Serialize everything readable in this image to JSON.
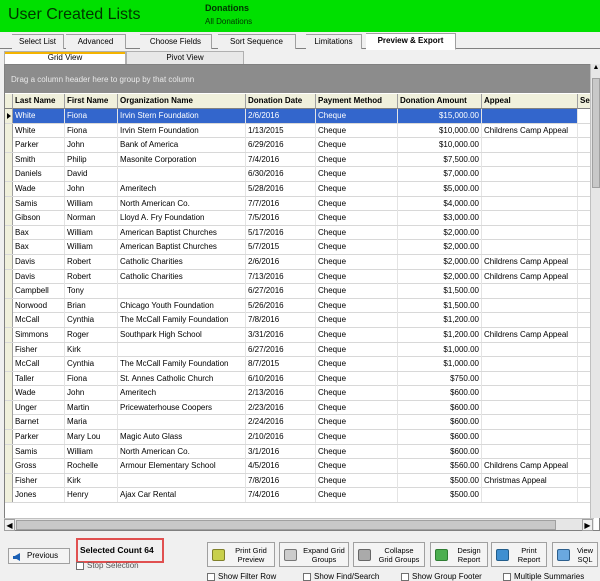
{
  "header": {
    "title": "User Created Lists",
    "subtitle": "Donations",
    "subtitle2": "All Donations",
    "bg_color": "#00e000"
  },
  "tabs": [
    {
      "label": "Select List"
    },
    {
      "label": "Advanced"
    },
    {
      "label": "Choose Fields"
    },
    {
      "label": "Sort Sequence"
    },
    {
      "label": "Limitations"
    },
    {
      "label": "Preview & Export",
      "active": true
    }
  ],
  "subtabs": [
    {
      "label": "Grid View",
      "active": true
    },
    {
      "label": "Pivot View"
    }
  ],
  "grid": {
    "group_hint": "Drag a column header here to group by that column",
    "columns": [
      "Last Name",
      "First Name",
      "Organization Name",
      "Donation Date",
      "Payment Method",
      "Donation Amount",
      "Appeal",
      "Ser"
    ],
    "rows": [
      [
        "White",
        "Fiona",
        "Irvin Stern Foundation",
        "2/6/2016",
        "Cheque",
        "$15,000.00",
        ""
      ],
      [
        "White",
        "Fiona",
        "Irvin Stern Foundation",
        "1/13/2015",
        "Cheque",
        "$10,000.00",
        "Childrens Camp  Appeal"
      ],
      [
        "Parker",
        "John",
        "Bank of America",
        "6/29/2016",
        "Cheque",
        "$10,000.00",
        ""
      ],
      [
        "Smith",
        "Philip",
        "Masonite Corporation",
        "7/4/2016",
        "Cheque",
        "$7,500.00",
        ""
      ],
      [
        "Daniels",
        "David",
        "",
        "6/30/2016",
        "Cheque",
        "$7,000.00",
        ""
      ],
      [
        "Wade",
        "John",
        "Ameritech",
        "5/28/2016",
        "Cheque",
        "$5,000.00",
        ""
      ],
      [
        "Samis",
        "William",
        "North American Co.",
        "7/7/2016",
        "Cheque",
        "$4,000.00",
        ""
      ],
      [
        "Gibson",
        "Norman",
        "Lloyd A. Fry Foundation",
        "7/5/2016",
        "Cheque",
        "$3,000.00",
        ""
      ],
      [
        "Bax",
        "William",
        "American Baptist Churches",
        "5/17/2016",
        "Cheque",
        "$2,000.00",
        ""
      ],
      [
        "Bax",
        "William",
        "American Baptist Churches",
        "5/7/2015",
        "Cheque",
        "$2,000.00",
        ""
      ],
      [
        "Davis",
        "Robert",
        "Catholic Charities",
        "2/6/2016",
        "Cheque",
        "$2,000.00",
        "Childrens Camp  Appeal"
      ],
      [
        "Davis",
        "Robert",
        "Catholic Charities",
        "7/13/2016",
        "Cheque",
        "$2,000.00",
        "Childrens Camp  Appeal"
      ],
      [
        "Campbell",
        "Tony",
        "",
        "6/27/2016",
        "Cheque",
        "$1,500.00",
        ""
      ],
      [
        "Norwood",
        "Brian",
        "Chicago Youth Foundation",
        "5/26/2016",
        "Cheque",
        "$1,500.00",
        ""
      ],
      [
        "McCall",
        "Cynthia",
        "The McCall Family Foundation",
        "7/8/2016",
        "Cheque",
        "$1,200.00",
        ""
      ],
      [
        "Simmons",
        "Roger",
        "Southpark High School",
        "3/31/2016",
        "Cheque",
        "$1,200.00",
        "Childrens Camp  Appeal"
      ],
      [
        "Fisher",
        "Kirk",
        "",
        "6/27/2016",
        "Cheque",
        "$1,000.00",
        ""
      ],
      [
        "McCall",
        "Cynthia",
        "The McCall Family Foundation",
        "8/7/2015",
        "Cheque",
        "$1,000.00",
        ""
      ],
      [
        "Taller",
        "Fiona",
        "St. Annes Catholic Church",
        "6/10/2016",
        "Cheque",
        "$750.00",
        ""
      ],
      [
        "Wade",
        "John",
        "Ameritech",
        "2/13/2016",
        "Cheque",
        "$600.00",
        ""
      ],
      [
        "Unger",
        "Martin",
        "Pricewaterhouse Coopers",
        "2/23/2016",
        "Cheque",
        "$600.00",
        ""
      ],
      [
        "Barnet",
        "Maria",
        "",
        "2/24/2016",
        "Cheque",
        "$600.00",
        ""
      ],
      [
        "Parker",
        "Mary Lou",
        "Magic Auto Glass",
        "2/10/2016",
        "Cheque",
        "$600.00",
        ""
      ],
      [
        "Samis",
        "William",
        "North American Co.",
        "3/1/2016",
        "Cheque",
        "$600.00",
        ""
      ],
      [
        "Gross",
        "Rochelle",
        "Armour Elementary School",
        "4/5/2016",
        "Cheque",
        "$560.00",
        "Childrens Camp  Appeal"
      ],
      [
        "Fisher",
        "Kirk",
        "",
        "7/8/2016",
        "Cheque",
        "$500.00",
        "Christmas Appeal"
      ],
      [
        "Jones",
        "Henry",
        "Ajax Car Rental",
        "7/4/2016",
        "Cheque",
        "$500.00",
        ""
      ]
    ]
  },
  "bottom": {
    "previous_label": "Previous",
    "selected_count_label": "Selected Count 64",
    "stop_selection_label": "Stop Selection",
    "buttons": [
      {
        "line1": "Print Grid",
        "line2": "Preview"
      },
      {
        "line1": "Expand Grid",
        "line2": "Groups"
      },
      {
        "line1": "Collapse",
        "line2": "Grid Groups"
      },
      {
        "line1": "Design",
        "line2": "Report"
      },
      {
        "line1": "Print",
        "line2": "Report"
      },
      {
        "line1": "View",
        "line2": "SQL"
      }
    ],
    "checkboxes": [
      "Show Filter Row",
      "Show Find/Search",
      "Show Group Footer",
      "Multiple Summaries"
    ]
  }
}
